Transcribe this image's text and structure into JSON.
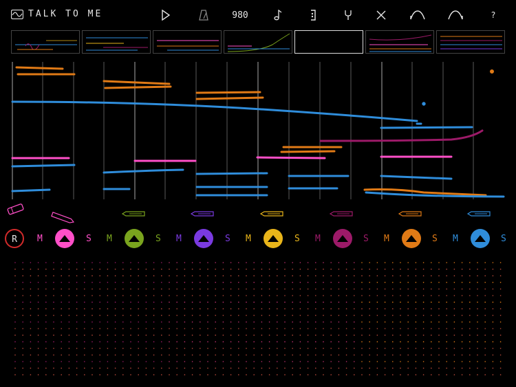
{
  "app": {
    "title": "TALK TO ME",
    "logo_icon": "waveform-box-icon"
  },
  "toolbar": {
    "tempo": "980",
    "help": "?",
    "icons": [
      "play-icon",
      "metronome-icon",
      "note-icon",
      "loop-bracket-icon",
      "tuning-fork-icon",
      "close-x-icon",
      "curve-ramp-icon",
      "curve-arc-icon"
    ]
  },
  "patterns": {
    "count": 7,
    "selected_index": 4
  },
  "record_button": {
    "label": "R",
    "color": "#d22b2b"
  },
  "tracks": [
    {
      "color": "#ff4fc8",
      "mute": "M",
      "solo": "S"
    },
    {
      "color": "#7aa41e",
      "mute": "M",
      "solo": "S"
    },
    {
      "color": "#7a3ae0",
      "mute": "M",
      "solo": "S"
    },
    {
      "color": "#e9b51a",
      "mute": "M",
      "solo": "S"
    },
    {
      "color": "#9c1a68",
      "mute": "M",
      "solo": "S"
    },
    {
      "color": "#e07a16",
      "mute": "M",
      "solo": "S"
    },
    {
      "color": "#2f8ddb",
      "mute": "M",
      "solo": "S"
    }
  ],
  "colors": {
    "background": "#000000",
    "grid": "#555555",
    "eraser": "#ff4fc8"
  }
}
